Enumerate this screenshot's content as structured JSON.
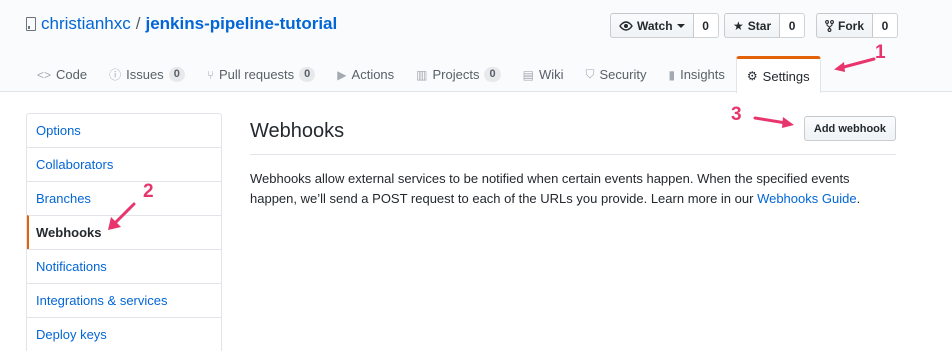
{
  "repo": {
    "owner": "christianhxc",
    "separator": "/",
    "name": "jenkins-pipeline-tutorial"
  },
  "actions": {
    "watch": {
      "label": "Watch",
      "count": "0"
    },
    "star": {
      "label": "Star",
      "count": "0"
    },
    "fork": {
      "label": "Fork",
      "count": "0"
    }
  },
  "tabs": [
    {
      "label": "Code",
      "icon": "code-icon"
    },
    {
      "label": "Issues",
      "icon": "issue-icon",
      "count": "0"
    },
    {
      "label": "Pull requests",
      "icon": "pull-request-icon",
      "count": "0"
    },
    {
      "label": "Actions",
      "icon": "play-icon"
    },
    {
      "label": "Projects",
      "icon": "project-icon",
      "count": "0"
    },
    {
      "label": "Wiki",
      "icon": "book-icon"
    },
    {
      "label": "Security",
      "icon": "shield-icon"
    },
    {
      "label": "Insights",
      "icon": "graph-icon"
    },
    {
      "label": "Settings",
      "icon": "gear-icon"
    }
  ],
  "sidebar": {
    "items": [
      {
        "label": "Options"
      },
      {
        "label": "Collaborators"
      },
      {
        "label": "Branches"
      },
      {
        "label": "Webhooks"
      },
      {
        "label": "Notifications"
      },
      {
        "label": "Integrations & services"
      },
      {
        "label": "Deploy keys"
      }
    ]
  },
  "main": {
    "title": "Webhooks",
    "add_button": "Add webhook",
    "description": "Webhooks allow external services to be notified when certain events happen. When the specified events happen, we’ll send a POST request to each of the URLs you provide. Learn more in our ",
    "link_text": "Webhooks Guide",
    "description_end": "."
  },
  "annotations": {
    "one": "1",
    "two": "2",
    "three": "3",
    "color": "#e8356d"
  },
  "colors": {
    "link": "#0366d6",
    "accent": "#e36209"
  }
}
